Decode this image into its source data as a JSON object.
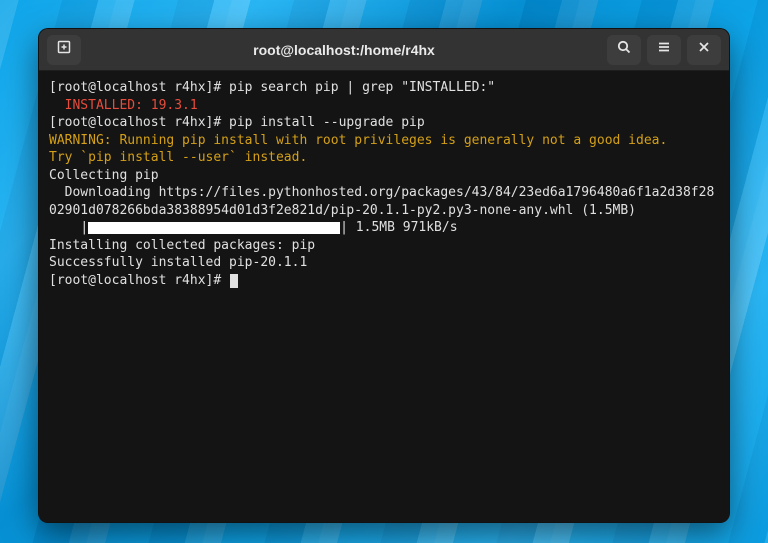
{
  "window": {
    "title": "root@localhost:/home/r4hx"
  },
  "term": {
    "prompt": "[root@localhost r4hx]# ",
    "cmd1": "pip search pip | grep \"INSTALLED:\"",
    "installed_label": "  INSTALLED: ",
    "installed_ver": "19.3.1",
    "cmd2": "pip install --upgrade pip",
    "warn1": "WARNING: Running pip install with root privileges is generally not a good idea.",
    "warn2": "Try `pip install --user` instead.",
    "collecting": "Collecting pip",
    "downloading": "  Downloading https://files.pythonhosted.org/packages/43/84/23ed6a1796480a6f1a2d38f2802901d078266bda38388954d01d3f2e821d/pip-20.1.1-py2.py3-none-any.whl (1.5MB)",
    "progress_prefix": "    |",
    "progress_suffix": "| 1.5MB 971kB/s",
    "installing": "Installing collected packages: pip",
    "success": "Successfully installed pip-20.1.1"
  }
}
